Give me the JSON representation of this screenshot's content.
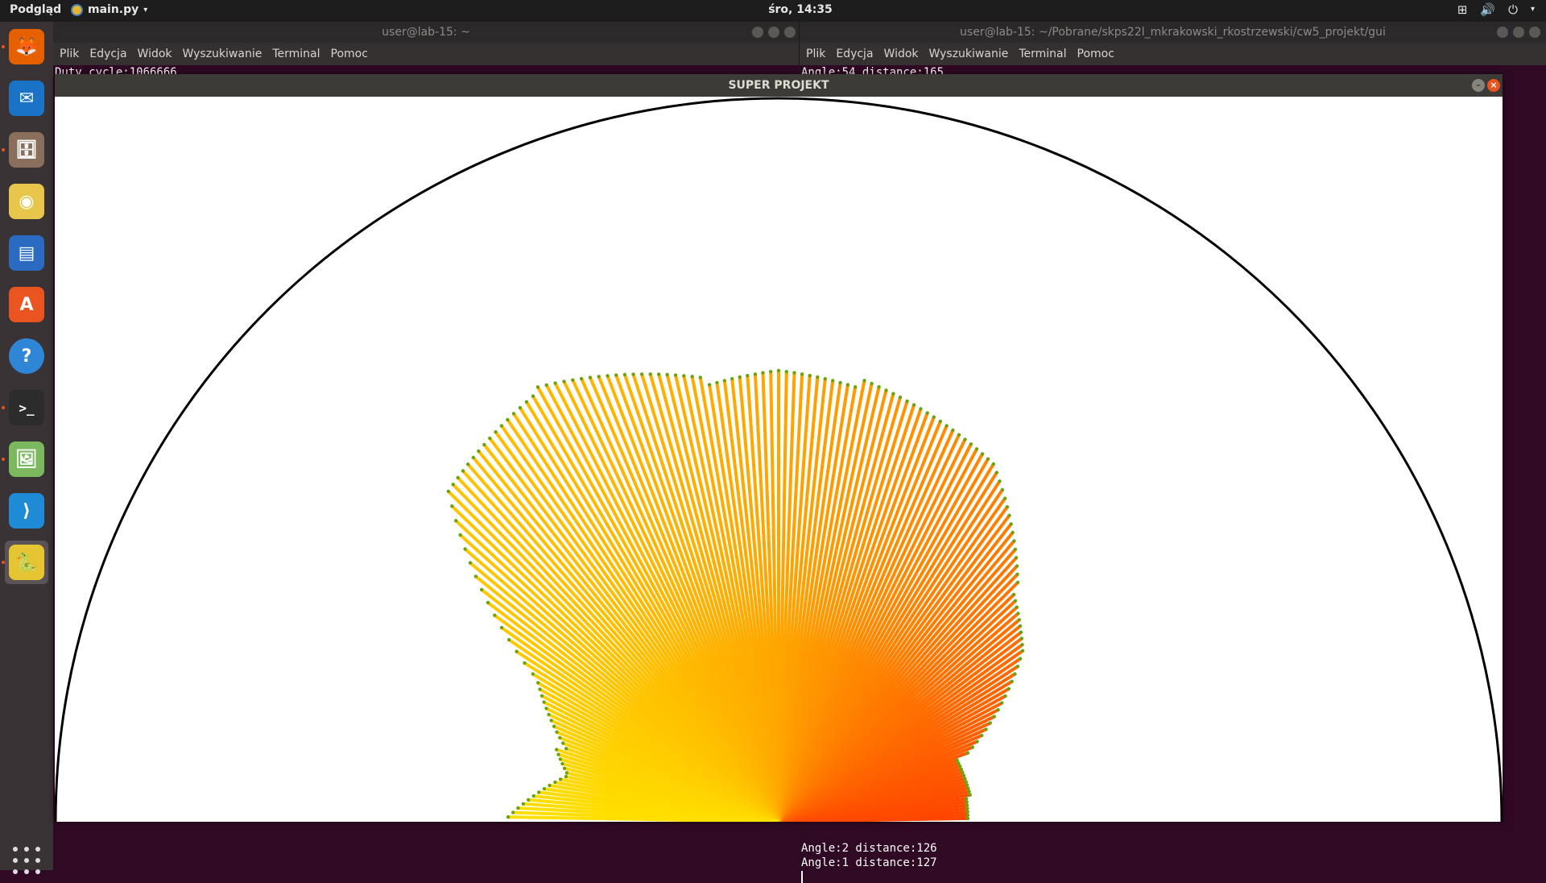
{
  "topbar": {
    "activities": "Podgląd",
    "app_name": "main.py",
    "clock": "śro, 14:35"
  },
  "dock": {
    "items": [
      {
        "name": "firefox",
        "icon": "firefox-icon",
        "color": "#e66000"
      },
      {
        "name": "thunderbird",
        "icon": "thunderbird-icon",
        "color": "#1a73c7"
      },
      {
        "name": "files",
        "icon": "file-manager-icon",
        "color": "#8a6f5c"
      },
      {
        "name": "rhythmbox",
        "icon": "music-player-icon",
        "color": "#e8c64b"
      },
      {
        "name": "writer",
        "icon": "document-writer-icon",
        "color": "#2a6bc1"
      },
      {
        "name": "software",
        "icon": "software-center-icon",
        "color": "#e95420"
      },
      {
        "name": "help",
        "icon": "help-icon",
        "color": "#2f86d6"
      },
      {
        "name": "terminal",
        "icon": "terminal-icon",
        "color": "#2c2c2c"
      },
      {
        "name": "image-viewer",
        "icon": "image-viewer-icon",
        "color": "#7bb85e"
      },
      {
        "name": "vscode",
        "icon": "vscode-icon",
        "color": "#1f8ad6"
      },
      {
        "name": "python-app",
        "icon": "python-app-icon",
        "color": "#e5c531"
      }
    ]
  },
  "terminal_left": {
    "title": "user@lab-15: ~",
    "menu": [
      "Plik",
      "Edycja",
      "Widok",
      "Wyszukiwanie",
      "Terminal",
      "Pomoc"
    ],
    "top_line": "Duty cycle:1066666"
  },
  "terminal_right": {
    "title": "user@lab-15: ~/Pobrane/skps22l_mkrakowski_rkostrzewski/cw5_projekt/gui",
    "menu": [
      "Plik",
      "Edycja",
      "Widok",
      "Wyszukiwanie",
      "Terminal",
      "Pomoc"
    ],
    "top_line": "Angle:54 distance:165",
    "bottom_lines": [
      "Angle:2 distance:126",
      "Angle:1 distance:127"
    ]
  },
  "app_window": {
    "title": "SUPER PROJEKT",
    "colors": {
      "near": "#ff4500",
      "mid": "#ffa500",
      "far": "#ffe000",
      "tip": "#6aa30a",
      "arc": "#000000"
    }
  }
}
